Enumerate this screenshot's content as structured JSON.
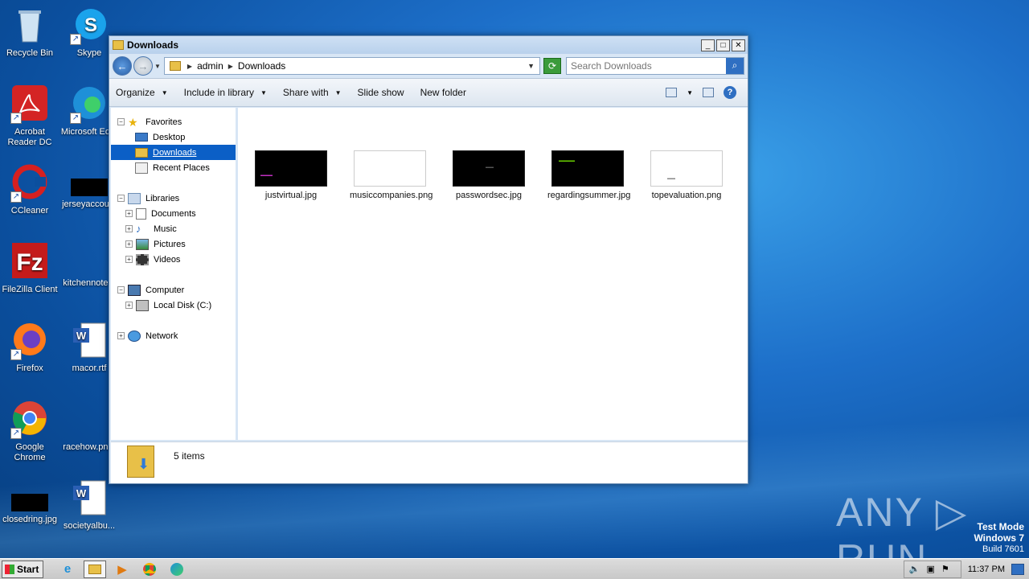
{
  "desktop": {
    "icons": [
      {
        "label": "Recycle Bin"
      },
      {
        "label": "Skype"
      },
      {
        "label": "Acrobat Reader DC"
      },
      {
        "label": "Microsoft Ed..."
      },
      {
        "label": "CCleaner"
      },
      {
        "label": "jerseyaccou..."
      },
      {
        "label": "FileZilla Client"
      },
      {
        "label": "kitchennote..."
      },
      {
        "label": "Firefox"
      },
      {
        "label": "macor.rtf"
      },
      {
        "label": "Google Chrome"
      },
      {
        "label": "racehow.pn..."
      },
      {
        "label": "closedring.jpg"
      },
      {
        "label": "societyalbu..."
      }
    ]
  },
  "window": {
    "title": "Downloads",
    "controls": {
      "minimize": "_",
      "maximize": "□",
      "close": "✕"
    },
    "breadcrumb": [
      "admin",
      "Downloads"
    ],
    "search_placeholder": "Search Downloads",
    "toolbar": {
      "organize": "Organize",
      "include_in_library": "Include in library",
      "share_with": "Share with",
      "slide_show": "Slide show",
      "new_folder": "New folder"
    },
    "nav_tree": {
      "favorites": "Favorites",
      "desktop": "Desktop",
      "downloads": "Downloads",
      "recent_places": "Recent Places",
      "libraries": "Libraries",
      "documents": "Documents",
      "music": "Music",
      "pictures": "Pictures",
      "videos": "Videos",
      "computer": "Computer",
      "local_disk": "Local Disk (C:)",
      "network": "Network"
    },
    "files": [
      {
        "name": "justvirtual.jpg",
        "thumb": "dark"
      },
      {
        "name": "musiccompanies.png",
        "thumb": "light"
      },
      {
        "name": "passwordsec.jpg",
        "thumb": "dark"
      },
      {
        "name": "regardingsummer.jpg",
        "thumb": "dark"
      },
      {
        "name": "topevaluation.png",
        "thumb": "light"
      }
    ],
    "status": "5 items"
  },
  "watermark": {
    "brand": "ANY ▷ RUN",
    "test_mode": "Test Mode",
    "os": "Windows 7",
    "build": "Build 7601"
  },
  "taskbar": {
    "start": "Start",
    "clock": "11:37 PM"
  },
  "colors": {
    "selection": "#0b5fc6",
    "desktop_blue": "#1d6fc9"
  }
}
